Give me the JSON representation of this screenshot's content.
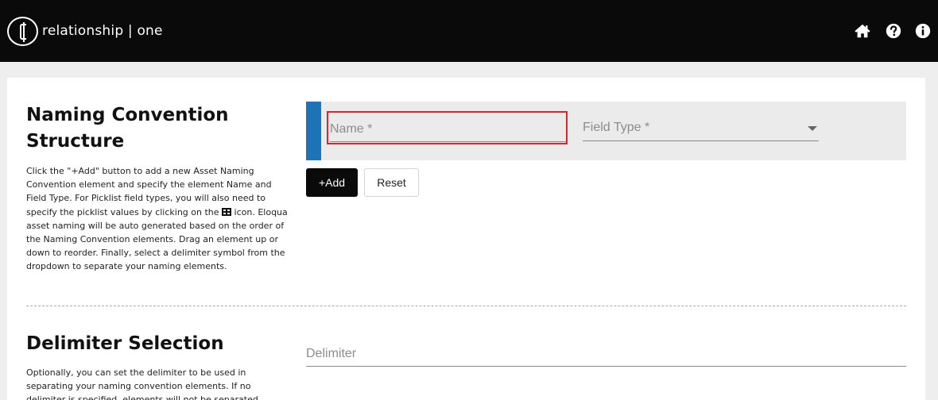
{
  "header": {
    "brand": "relationship | one",
    "icons": [
      "home-icon",
      "help-icon",
      "info-icon"
    ]
  },
  "naming_section": {
    "title_line1": "Naming Convention",
    "title_line2": "Structure",
    "description_before_icon": "Click the \"+Add\" button to add a new Asset Naming Convention element and specify the element Name and Field Type. For Picklist field types, you will also need to specify the picklist values by clicking on the ",
    "description_after_icon": " icon. Eloqua asset naming will be auto generated based on the order of the Naming Convention elements. Drag an element up or down to reorder. Finally, select a delimiter symbol from the dropdown to separate your naming elements.",
    "name_placeholder": "Name *",
    "name_value": "",
    "field_type_label": "Field Type *",
    "add_label": "+Add",
    "reset_label": "Reset"
  },
  "delimiter_section": {
    "title": "Delimiter Selection",
    "description": "Optionally, you can set the delimiter to be used in separating your naming convention elements. If no delimiter is specified, elements will not be separated.",
    "delimiter_placeholder": "Delimiter",
    "delimiter_value": ""
  },
  "colors": {
    "header_bg": "#0a0a0a",
    "accent_blue": "#1d73b8",
    "highlight_red": "#d9262c"
  }
}
